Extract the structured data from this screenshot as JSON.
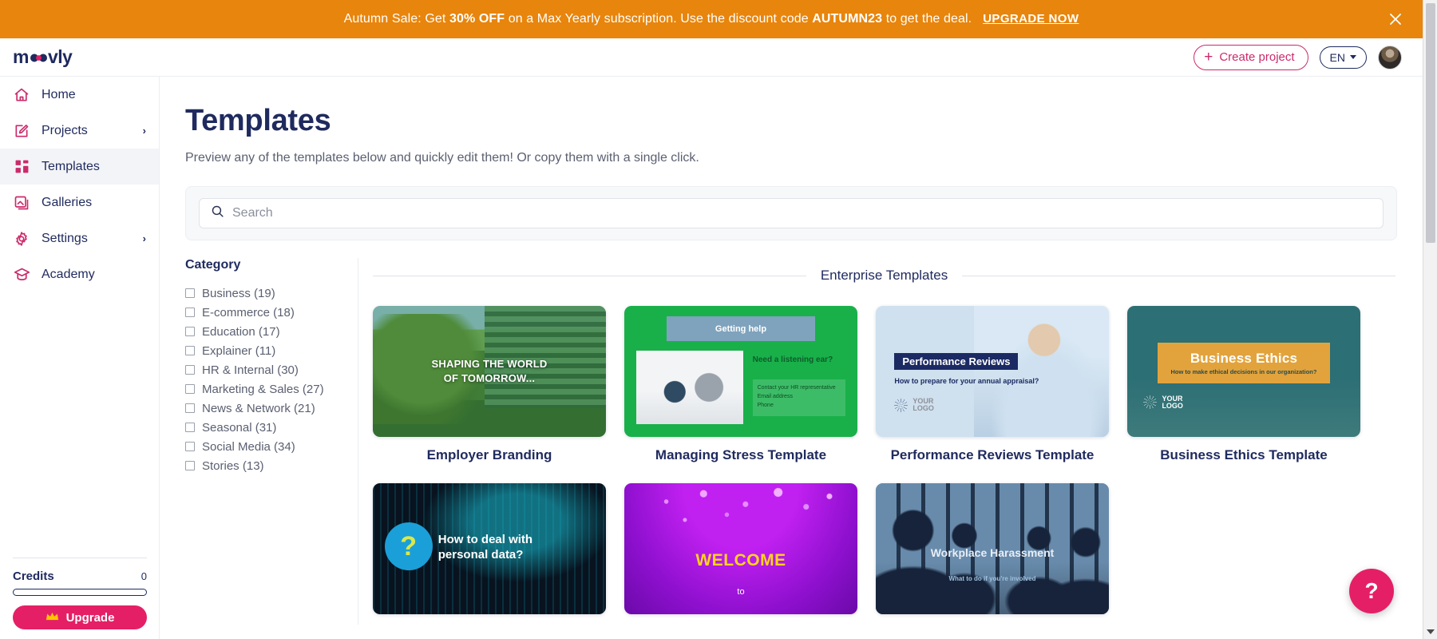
{
  "promo": {
    "text_prefix": "Autumn Sale: Get ",
    "discount": "30% OFF",
    "text_middle": " on a Max Yearly subscription. Use the discount code ",
    "code": "AUTUMN23",
    "text_suffix": " to get the deal.",
    "cta": "UPGRADE NOW",
    "bg_color": "#e8850c",
    "close_icon": "close-icon"
  },
  "header": {
    "logo_text": "moovly",
    "create_button": "Create project",
    "create_icon": "plus-icon",
    "language": "EN",
    "language_caret": "chevron-down-icon",
    "avatar": "user-avatar",
    "accent_color": "#cc2a6b"
  },
  "sidebar": {
    "items": [
      {
        "label": "Home",
        "icon": "home-icon",
        "active": false,
        "chevron": ""
      },
      {
        "label": "Projects",
        "icon": "edit-square-icon",
        "active": false,
        "chevron": "›"
      },
      {
        "label": "Templates",
        "icon": "grid-icon",
        "active": true,
        "chevron": ""
      },
      {
        "label": "Galleries",
        "icon": "image-icon",
        "active": false,
        "chevron": ""
      },
      {
        "label": "Settings",
        "icon": "gear-icon",
        "active": false,
        "chevron": "›"
      },
      {
        "label": "Academy",
        "icon": "graduation-cap-icon",
        "active": false,
        "chevron": ""
      }
    ],
    "credits_label": "Credits",
    "credits_value": "0",
    "credits_progress_pct": 0,
    "upgrade_label": "Upgrade",
    "upgrade_icon": "crown-icon",
    "upgrade_color": "#e51f66"
  },
  "main": {
    "title": "Templates",
    "subtitle": "Preview any of the templates below and quickly edit them! Or copy them with a single click.",
    "search": {
      "placeholder": "Search",
      "value": "",
      "icon": "search-icon"
    },
    "category": {
      "title": "Category",
      "items": [
        {
          "label": "Business (19)",
          "checked": false
        },
        {
          "label": "E-commerce (18)",
          "checked": false
        },
        {
          "label": "Education (17)",
          "checked": false
        },
        {
          "label": "Explainer (11)",
          "checked": false
        },
        {
          "label": "HR & Internal (30)",
          "checked": false
        },
        {
          "label": "Marketing & Sales (27)",
          "checked": false
        },
        {
          "label": "News & Network (21)",
          "checked": false
        },
        {
          "label": "Seasonal (31)",
          "checked": false
        },
        {
          "label": "Social Media (34)",
          "checked": false
        },
        {
          "label": "Stories (13)",
          "checked": false
        }
      ]
    },
    "section_title": "Enterprise Templates",
    "templates": [
      {
        "name": "Employer Branding",
        "thumb_style": "t-employer",
        "overlay_line1": "SHAPING THE WORLD",
        "overlay_line2": "OF TOMORROW..."
      },
      {
        "name": "Managing Stress Template",
        "thumb_style": "t-stress",
        "bar_text": "Getting help",
        "question": "Need a listening ear?",
        "panel_line1": "Contact your HR representative",
        "panel_line2": "Email address",
        "panel_line3": "Phone"
      },
      {
        "name": "Performance Reviews Template",
        "thumb_style": "t-perf",
        "title_bar": "Performance Reviews",
        "subtitle": "How to prepare for your annual appraisal?",
        "logo_line1": "YOUR",
        "logo_line2": "LOGO"
      },
      {
        "name": "Business Ethics Template",
        "thumb_style": "t-ethics",
        "band_title": "Business Ethics",
        "band_sub": "How to make ethical decisions in our organization?",
        "logo_line1": "YOUR",
        "logo_line2": "LOGO"
      },
      {
        "name": "",
        "thumb_style": "t-data",
        "qmark": "?",
        "line1": "How to deal with",
        "line2": "personal data?"
      },
      {
        "name": "",
        "thumb_style": "t-welcome",
        "word1": "WELCOME",
        "word2": "to"
      },
      {
        "name": "",
        "thumb_style": "t-harass",
        "title": "Workplace Harassment",
        "subtitle": "What to do if you're involved"
      }
    ]
  },
  "help_fab": {
    "label": "?",
    "color": "#e51f66"
  }
}
